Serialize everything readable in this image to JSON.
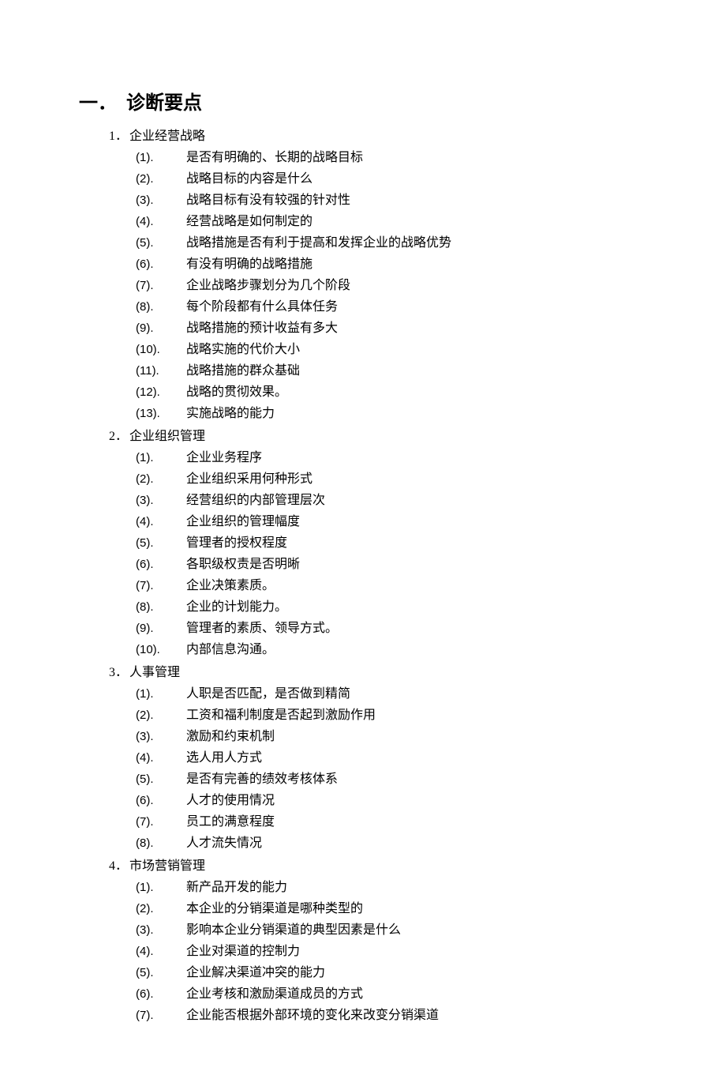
{
  "heading": {
    "number": "一．",
    "title": "诊断要点"
  },
  "sections": [
    {
      "number": "1．",
      "title": "企业经营战略",
      "items": [
        "是否有明确的、长期的战略目标",
        "战略目标的内容是什么",
        "战略目标有没有较强的针对性",
        "经营战略是如何制定的",
        "战略措施是否有利于提高和发挥企业的战略优势",
        "有没有明确的战略措施",
        "企业战略步骤划分为几个阶段",
        "每个阶段都有什么具体任务",
        "战略措施的预计收益有多大",
        "战略实施的代价大小",
        "战略措施的群众基础",
        "战略的贯彻效果。",
        "实施战略的能力"
      ]
    },
    {
      "number": "2．",
      "title": "企业组织管理",
      "items": [
        "企业业务程序",
        "企业组织采用何种形式",
        "经营组织的内部管理层次",
        "企业组织的管理幅度",
        "管理者的授权程度",
        "各职级权责是否明晰",
        "企业决策素质。",
        "企业的计划能力。",
        "管理者的素质、领导方式。",
        "内部信息沟通。"
      ]
    },
    {
      "number": "3．",
      "title": "人事管理",
      "items": [
        "人职是否匹配，是否做到精简",
        "工资和福利制度是否起到激励作用",
        "激励和约束机制",
        "选人用人方式",
        "是否有完善的绩效考核体系",
        "人才的使用情况",
        "员工的满意程度",
        "人才流失情况"
      ]
    },
    {
      "number": "4．",
      "title": "市场营销管理",
      "items": [
        "新产品开发的能力",
        "本企业的分销渠道是哪种类型的",
        "影响本企业分销渠道的典型因素是什么",
        "企业对渠道的控制力",
        "企业解决渠道冲突的能力",
        "企业考核和激励渠道成员的方式",
        "企业能否根据外部环境的变化来改变分销渠道"
      ]
    }
  ]
}
